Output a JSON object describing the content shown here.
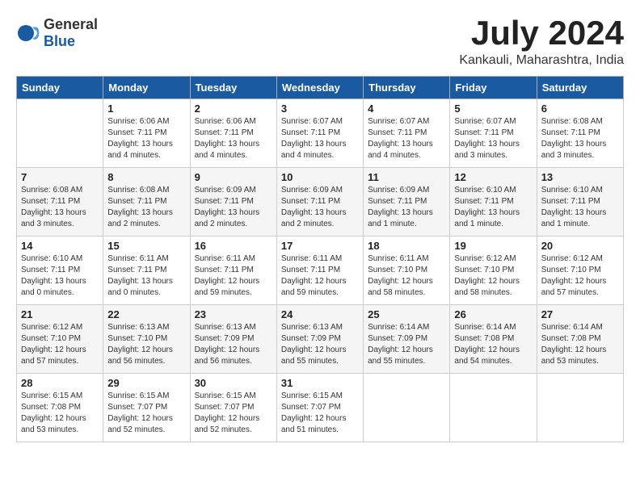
{
  "logo": {
    "general": "General",
    "blue": "Blue"
  },
  "title": "July 2024",
  "subtitle": "Kankauli, Maharashtra, India",
  "days_of_week": [
    "Sunday",
    "Monday",
    "Tuesday",
    "Wednesday",
    "Thursday",
    "Friday",
    "Saturday"
  ],
  "weeks": [
    [
      {
        "day": "",
        "info": ""
      },
      {
        "day": "1",
        "info": "Sunrise: 6:06 AM\nSunset: 7:11 PM\nDaylight: 13 hours\nand 4 minutes."
      },
      {
        "day": "2",
        "info": "Sunrise: 6:06 AM\nSunset: 7:11 PM\nDaylight: 13 hours\nand 4 minutes."
      },
      {
        "day": "3",
        "info": "Sunrise: 6:07 AM\nSunset: 7:11 PM\nDaylight: 13 hours\nand 4 minutes."
      },
      {
        "day": "4",
        "info": "Sunrise: 6:07 AM\nSunset: 7:11 PM\nDaylight: 13 hours\nand 4 minutes."
      },
      {
        "day": "5",
        "info": "Sunrise: 6:07 AM\nSunset: 7:11 PM\nDaylight: 13 hours\nand 3 minutes."
      },
      {
        "day": "6",
        "info": "Sunrise: 6:08 AM\nSunset: 7:11 PM\nDaylight: 13 hours\nand 3 minutes."
      }
    ],
    [
      {
        "day": "7",
        "info": "Sunrise: 6:08 AM\nSunset: 7:11 PM\nDaylight: 13 hours\nand 3 minutes."
      },
      {
        "day": "8",
        "info": "Sunrise: 6:08 AM\nSunset: 7:11 PM\nDaylight: 13 hours\nand 2 minutes."
      },
      {
        "day": "9",
        "info": "Sunrise: 6:09 AM\nSunset: 7:11 PM\nDaylight: 13 hours\nand 2 minutes."
      },
      {
        "day": "10",
        "info": "Sunrise: 6:09 AM\nSunset: 7:11 PM\nDaylight: 13 hours\nand 2 minutes."
      },
      {
        "day": "11",
        "info": "Sunrise: 6:09 AM\nSunset: 7:11 PM\nDaylight: 13 hours\nand 1 minute."
      },
      {
        "day": "12",
        "info": "Sunrise: 6:10 AM\nSunset: 7:11 PM\nDaylight: 13 hours\nand 1 minute."
      },
      {
        "day": "13",
        "info": "Sunrise: 6:10 AM\nSunset: 7:11 PM\nDaylight: 13 hours\nand 1 minute."
      }
    ],
    [
      {
        "day": "14",
        "info": "Sunrise: 6:10 AM\nSunset: 7:11 PM\nDaylight: 13 hours\nand 0 minutes."
      },
      {
        "day": "15",
        "info": "Sunrise: 6:11 AM\nSunset: 7:11 PM\nDaylight: 13 hours\nand 0 minutes."
      },
      {
        "day": "16",
        "info": "Sunrise: 6:11 AM\nSunset: 7:11 PM\nDaylight: 12 hours\nand 59 minutes."
      },
      {
        "day": "17",
        "info": "Sunrise: 6:11 AM\nSunset: 7:11 PM\nDaylight: 12 hours\nand 59 minutes."
      },
      {
        "day": "18",
        "info": "Sunrise: 6:11 AM\nSunset: 7:10 PM\nDaylight: 12 hours\nand 58 minutes."
      },
      {
        "day": "19",
        "info": "Sunrise: 6:12 AM\nSunset: 7:10 PM\nDaylight: 12 hours\nand 58 minutes."
      },
      {
        "day": "20",
        "info": "Sunrise: 6:12 AM\nSunset: 7:10 PM\nDaylight: 12 hours\nand 57 minutes."
      }
    ],
    [
      {
        "day": "21",
        "info": "Sunrise: 6:12 AM\nSunset: 7:10 PM\nDaylight: 12 hours\nand 57 minutes."
      },
      {
        "day": "22",
        "info": "Sunrise: 6:13 AM\nSunset: 7:10 PM\nDaylight: 12 hours\nand 56 minutes."
      },
      {
        "day": "23",
        "info": "Sunrise: 6:13 AM\nSunset: 7:09 PM\nDaylight: 12 hours\nand 56 minutes."
      },
      {
        "day": "24",
        "info": "Sunrise: 6:13 AM\nSunset: 7:09 PM\nDaylight: 12 hours\nand 55 minutes."
      },
      {
        "day": "25",
        "info": "Sunrise: 6:14 AM\nSunset: 7:09 PM\nDaylight: 12 hours\nand 55 minutes."
      },
      {
        "day": "26",
        "info": "Sunrise: 6:14 AM\nSunset: 7:08 PM\nDaylight: 12 hours\nand 54 minutes."
      },
      {
        "day": "27",
        "info": "Sunrise: 6:14 AM\nSunset: 7:08 PM\nDaylight: 12 hours\nand 53 minutes."
      }
    ],
    [
      {
        "day": "28",
        "info": "Sunrise: 6:15 AM\nSunset: 7:08 PM\nDaylight: 12 hours\nand 53 minutes."
      },
      {
        "day": "29",
        "info": "Sunrise: 6:15 AM\nSunset: 7:07 PM\nDaylight: 12 hours\nand 52 minutes."
      },
      {
        "day": "30",
        "info": "Sunrise: 6:15 AM\nSunset: 7:07 PM\nDaylight: 12 hours\nand 52 minutes."
      },
      {
        "day": "31",
        "info": "Sunrise: 6:15 AM\nSunset: 7:07 PM\nDaylight: 12 hours\nand 51 minutes."
      },
      {
        "day": "",
        "info": ""
      },
      {
        "day": "",
        "info": ""
      },
      {
        "day": "",
        "info": ""
      }
    ]
  ]
}
